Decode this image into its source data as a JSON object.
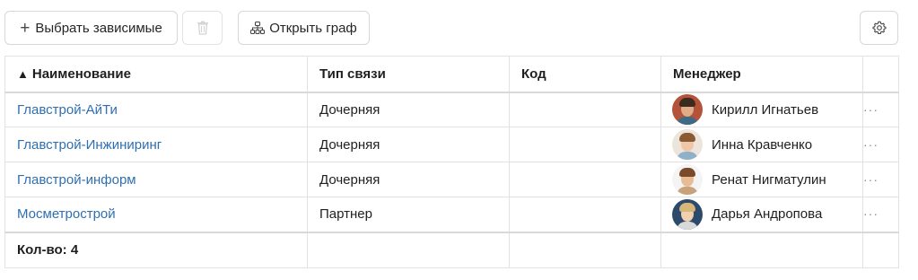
{
  "toolbar": {
    "add_dependents_label": "Выбрать зависимые",
    "open_graph_label": "Открыть граф",
    "icons": {
      "add": "plus-icon",
      "delete": "trash-icon",
      "graph": "org-chart-icon",
      "settings": "gear-icon"
    }
  },
  "table": {
    "columns": [
      "Наименование",
      "Тип связи",
      "Код",
      "Менеджер",
      ""
    ],
    "sort_indicator": "▲",
    "rows": [
      {
        "name": "Главстрой-АйТи",
        "relation": "Дочерняя",
        "code": "",
        "manager": "Кирилл Игнатьев"
      },
      {
        "name": "Главстрой-Инжиниринг",
        "relation": "Дочерняя",
        "code": "",
        "manager": "Инна Кравченко"
      },
      {
        "name": "Главстрой-информ",
        "relation": "Дочерняя",
        "code": "",
        "manager": "Ренат Нигматулин"
      },
      {
        "name": "Мосметрострой",
        "relation": "Партнер",
        "code": "",
        "manager": "Дарья Андропова"
      }
    ],
    "footer": {
      "count_label": "Кол-во: 4"
    },
    "row_menu_label": "···"
  },
  "colors": {
    "link": "#2f6fb0",
    "border": "#e2e2e2"
  }
}
